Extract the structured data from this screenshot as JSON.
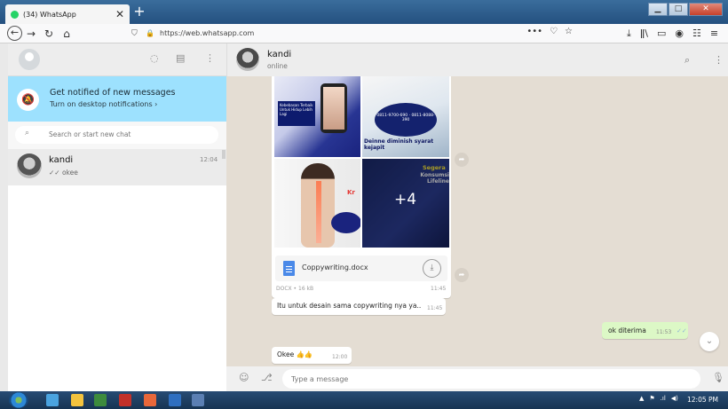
{
  "browser": {
    "tab_title": "(34) WhatsApp",
    "tab_close": "✕",
    "new_tab": "+",
    "url": "https://web.whatsapp.com",
    "window_buttons": [
      "▁",
      "□",
      "✕"
    ],
    "nav": {
      "back": "←",
      "forward": "→",
      "reload": "↻",
      "home": "⌂"
    },
    "url_actions": [
      "•••",
      "♡",
      "☆"
    ],
    "toolbar_icons": [
      "⤓",
      "ǁ\\",
      "▭",
      "◉",
      "☷",
      "≡"
    ]
  },
  "sidebar": {
    "header_icons": [
      "◌",
      "▤",
      "⋮"
    ],
    "notification": {
      "title": "Get notified of new messages",
      "subtitle": "Turn on desktop notifications ›",
      "icon": "bell-off-icon"
    },
    "search": {
      "placeholder": "Search or start new chat",
      "icon": "⌕"
    },
    "chats": [
      {
        "name": "kandi",
        "last_message": "✓✓ okee",
        "time": "12:04"
      }
    ]
  },
  "conversation": {
    "contact_name": "kandi",
    "status": "online",
    "header_icons": [
      "⌕",
      "⋮"
    ],
    "album": {
      "img1_text": "Kebebasan Terbaik Untuk Hidup Lebih Lagi",
      "img2_oval": "0811-9700-690 · 0811-8088-390",
      "img2_label": "Deinne   diminish syarat kejapit",
      "img3_word": "Kr",
      "img4_text1": "Segera",
      "img4_text2": "Konsumsi Lifeline",
      "more_count": "+4",
      "forward_icon": "➦"
    },
    "document": {
      "file_name": "Coppywriting.docx",
      "meta": "DOCX • 16 kB",
      "time": "11:45",
      "download_icon": "⤓",
      "forward_icon": "➦"
    },
    "caption": {
      "text": "Itu untuk desain sama copywriting nya ya..",
      "time": "11:45"
    },
    "outgoing": {
      "text": "ok diterima",
      "time": "11:53",
      "check": "✓✓"
    },
    "incoming": {
      "text": "Okee 👍👍",
      "time": "12:00"
    },
    "scroll_down_icon": "⌄",
    "composer": {
      "placeholder": "Type a message",
      "emoji_icon": "☺",
      "attach_icon": "⎇",
      "mic_icon": "🎙"
    }
  },
  "taskbar": {
    "tray_icons": [
      "▲",
      "⚑",
      ".ıl",
      "◀)"
    ],
    "time": "12:05 PM"
  }
}
